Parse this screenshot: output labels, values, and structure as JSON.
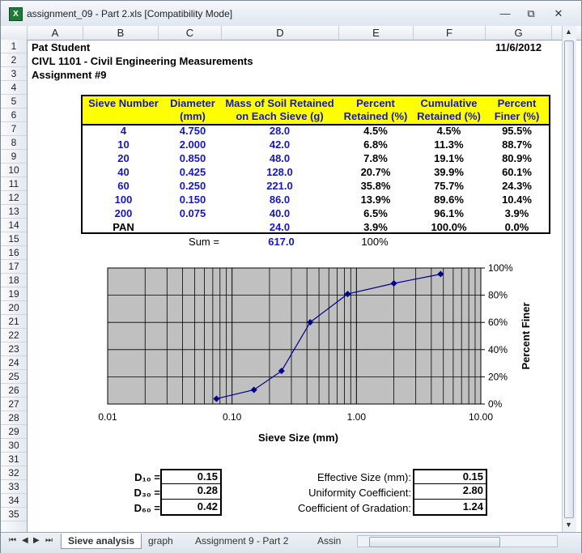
{
  "window": {
    "title": "assignment_09 - Part 2.xls  [Compatibility Mode]",
    "icon": "excel-icon"
  },
  "columns": [
    "A",
    "B",
    "C",
    "D",
    "E",
    "F",
    "G"
  ],
  "rows": [
    "1",
    "2",
    "3",
    "4",
    "5",
    "6",
    "7",
    "8",
    "9",
    "10",
    "11",
    "12",
    "13",
    "14",
    "15",
    "16",
    "17",
    "18",
    "19",
    "20",
    "21",
    "22",
    "23",
    "24",
    "25",
    "26",
    "27",
    "28",
    "29",
    "30",
    "31",
    "32",
    "33",
    "34",
    "35"
  ],
  "header": {
    "name": "Pat Student",
    "date": "11/6/2012",
    "course": "CIVL 1101 - Civil Engineering Measurements",
    "assignment": "Assignment #9"
  },
  "table": {
    "headers": [
      [
        "Sieve Number",
        ""
      ],
      [
        "Diameter",
        "(mm)"
      ],
      [
        "Mass of Soil Retained",
        "on Each Sieve (g)"
      ],
      [
        "Percent",
        "Retained (%)"
      ],
      [
        "Cumulative",
        "Retained (%)"
      ],
      [
        "Percent",
        "Finer (%)"
      ]
    ],
    "rows": [
      [
        "4",
        "4.750",
        "28.0",
        "4.5%",
        "4.5%",
        "95.5%"
      ],
      [
        "10",
        "2.000",
        "42.0",
        "6.8%",
        "11.3%",
        "88.7%"
      ],
      [
        "20",
        "0.850",
        "48.0",
        "7.8%",
        "19.1%",
        "80.9%"
      ],
      [
        "40",
        "0.425",
        "128.0",
        "20.7%",
        "39.9%",
        "60.1%"
      ],
      [
        "60",
        "0.250",
        "221.0",
        "35.8%",
        "75.7%",
        "24.3%"
      ],
      [
        "100",
        "0.150",
        "86.0",
        "13.9%",
        "89.6%",
        "10.4%"
      ],
      [
        "200",
        "0.075",
        "40.0",
        "6.5%",
        "96.1%",
        "3.9%"
      ],
      [
        "PAN",
        "",
        "24.0",
        "3.9%",
        "100.0%",
        "0.0%"
      ]
    ],
    "sum_label": "Sum =",
    "sum_mass": "617.0",
    "sum_percent": "100%",
    "header_bg": "#ffff00"
  },
  "chart_data": {
    "type": "scatter",
    "x": [
      4.75,
      2.0,
      0.85,
      0.425,
      0.25,
      0.15,
      0.075
    ],
    "y": [
      95.5,
      88.7,
      80.9,
      60.1,
      24.3,
      10.4,
      3.9
    ],
    "xlabel": "Sieve Size (mm)",
    "ylabel": "Percent Finer",
    "x_scale": "log",
    "xlim": [
      0.01,
      10.0
    ],
    "ylim": [
      0,
      100
    ],
    "x_ticks": [
      "0.01",
      "0.10",
      "1.00",
      "10.00"
    ],
    "y_ticks": [
      "0%",
      "20%",
      "40%",
      "60%",
      "80%",
      "100%"
    ],
    "plot_bg": "#c0c0c0",
    "line_color": "#00008b",
    "grid": true
  },
  "results": {
    "d10_label": "D₁₀ =",
    "d10": "0.15",
    "d30_label": "D₃₀ =",
    "d30": "0.28",
    "d60_label": "D₆₀ =",
    "d60": "0.42",
    "eff_label": "Effective Size (mm):",
    "eff": "0.15",
    "cu_label": "Uniformity Coefficient:",
    "cu": "2.80",
    "cc_label": "Coefficient of Gradation:",
    "cc": "1.24"
  },
  "tabs": [
    {
      "label": "Sieve analysis",
      "active": true
    },
    {
      "label": "graph",
      "active": false
    },
    {
      "label": "Assignment 9 - Part 2",
      "active": false
    },
    {
      "label": "Assin",
      "active": false
    }
  ]
}
